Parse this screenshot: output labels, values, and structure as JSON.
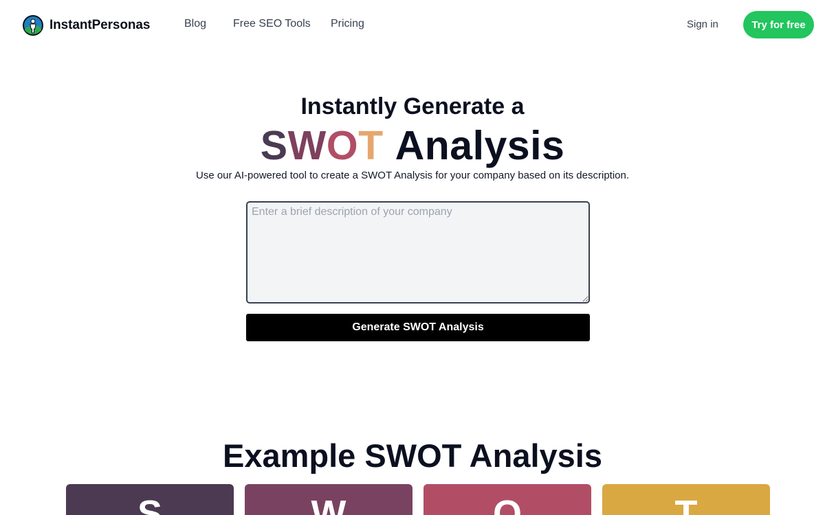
{
  "header": {
    "brand_name": "InstantPersonas",
    "nav": [
      {
        "label": "Blog"
      },
      {
        "label": "Free SEO Tools"
      },
      {
        "label": "Pricing"
      }
    ],
    "signin_label": "Sign in",
    "cta_label": "Try for free"
  },
  "hero": {
    "line1": "Instantly Generate a",
    "swot_letters": [
      "S",
      "W",
      "O",
      "T"
    ],
    "line2_rest": "Analysis",
    "subtitle": "Use our AI-powered tool to create a SWOT Analysis for your company based on its description."
  },
  "form": {
    "placeholder": "Enter a brief description of your company",
    "value": "",
    "button_label": "Generate SWOT Analysis"
  },
  "example": {
    "title": "Example SWOT Analysis",
    "cards": [
      {
        "letter": "S",
        "color": "#4b3a52"
      },
      {
        "letter": "W",
        "color": "#7a4261"
      },
      {
        "letter": "O",
        "color": "#b14e66"
      },
      {
        "letter": "T",
        "color": "#d9a842"
      }
    ]
  },
  "colors": {
    "accent_green": "#22c55e",
    "swot_s": "#4b3a52",
    "swot_w": "#7e405e",
    "swot_o": "#b14e66",
    "swot_t": "#e6a76f"
  }
}
